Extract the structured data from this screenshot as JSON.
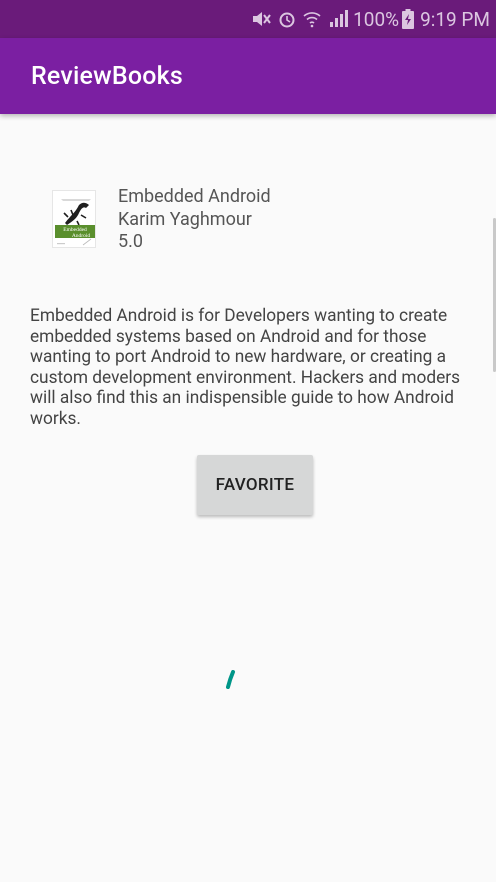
{
  "status_bar": {
    "battery": "100%",
    "time": "9:19 PM",
    "icons": [
      "mute-icon",
      "alarm-icon",
      "wifi-icon",
      "signal-icon",
      "battery-charging-icon"
    ]
  },
  "app_bar": {
    "title": "ReviewBooks",
    "color": "#7b1fa2"
  },
  "book": {
    "cover_icon": "book-cover-embedded-android",
    "title": "Embedded Android",
    "author": "Karim Yaghmour",
    "rating": "5.0",
    "description": "Embedded Android is for Developers wanting to create embedded systems based on Android and for those wanting to port Android to new hardware, or creating a custom development environment. Hackers and moders will also find this an indispensible guide to how Android works."
  },
  "actions": {
    "favorite_label": "FAVORITE"
  },
  "loading": {
    "spinner_color": "#009688"
  }
}
